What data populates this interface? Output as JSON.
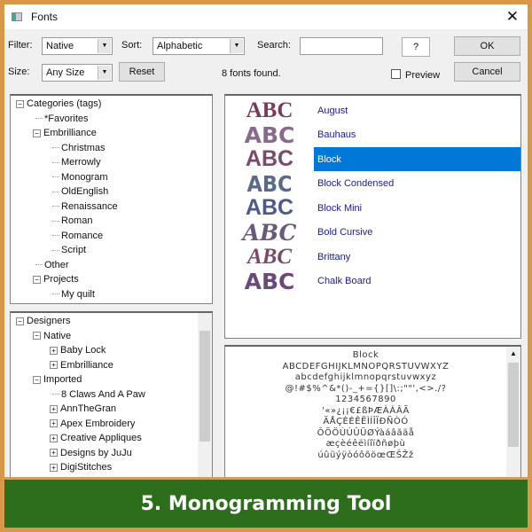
{
  "window": {
    "title": "Fonts",
    "close": "✕"
  },
  "toolbar": {
    "filter_label": "Filter:",
    "filter_value": "Native",
    "sort_label": "Sort:",
    "sort_value": "Alphabetic",
    "search_label": "Search:",
    "search_value": "",
    "help": "?",
    "ok": "OK",
    "size_label": "Size:",
    "size_value": "Any Size",
    "reset": "Reset",
    "found": "8 fonts found.",
    "preview": "Preview",
    "preview_checked": false,
    "cancel": "Cancel"
  },
  "categories": [
    {
      "label": "Categories (tags)",
      "level": 0,
      "box": "−"
    },
    {
      "label": "*Favorites",
      "level": 1
    },
    {
      "label": "Embrilliance",
      "level": 1,
      "box": "−"
    },
    {
      "label": "Christmas",
      "level": 2
    },
    {
      "label": "Merrowly",
      "level": 2
    },
    {
      "label": "Monogram",
      "level": 2
    },
    {
      "label": "OldEnglish",
      "level": 2
    },
    {
      "label": "Renaissance",
      "level": 2
    },
    {
      "label": "Roman",
      "level": 2
    },
    {
      "label": "Romance",
      "level": 2
    },
    {
      "label": "Script",
      "level": 2
    },
    {
      "label": "Other",
      "level": 1
    },
    {
      "label": "Projects",
      "level": 1,
      "box": "−"
    },
    {
      "label": "My quilt",
      "level": 2
    }
  ],
  "designers": [
    {
      "label": "Designers",
      "level": 0,
      "box": "−"
    },
    {
      "label": "Native",
      "level": 1,
      "box": "−"
    },
    {
      "label": "Baby Lock",
      "level": 2,
      "box": "+"
    },
    {
      "label": "Embrilliance",
      "level": 2,
      "box": "+"
    },
    {
      "label": "Imported",
      "level": 1,
      "box": "−"
    },
    {
      "label": "8 Claws And A Paw",
      "level": 2
    },
    {
      "label": "AnnTheGran",
      "level": 2,
      "box": "+"
    },
    {
      "label": "Apex Embroidery",
      "level": 2,
      "box": "+"
    },
    {
      "label": "Creative Appliques",
      "level": 2,
      "box": "+"
    },
    {
      "label": "Designs by JuJu",
      "level": 2,
      "box": "+"
    },
    {
      "label": "DigiStitches",
      "level": 2,
      "box": "+"
    }
  ],
  "fonts": [
    {
      "name": "August",
      "sample": "ABC",
      "color": "#7a3a5a"
    },
    {
      "name": "Bauhaus",
      "sample": "ABC",
      "color": "#8a6a8a"
    },
    {
      "name": "Block",
      "sample": "ABC",
      "color": "#7a4a6e",
      "selected": true
    },
    {
      "name": "Block Condensed",
      "sample": "ABC",
      "color": "#5a6a8a"
    },
    {
      "name": "Block Mini",
      "sample": "ABC",
      "color": "#4a5a8a"
    },
    {
      "name": "Bold Cursive",
      "sample": "ABC",
      "color": "#6a5a7a"
    },
    {
      "name": "Brittany",
      "sample": "ABC",
      "color": "#7a4a6a"
    },
    {
      "name": "Chalk Board",
      "sample": "ABC",
      "color": "#6a4a7a"
    }
  ],
  "preview_lines": [
    "Block",
    "ABCDEFGHIJKLMNOPQRSTUVWXYZ",
    "abcdefghijklmnopqrstuvwxyz",
    "@!#$%^&*()-_+={}[]\\:;\"\"',<>./?",
    "1234567890",
    "'«»¿¡¡€£ßÞÆÀÁÂÃ",
    "ÄÅÇÈÉÊËÌÍÎÏÐÑÒÓ",
    "ÔÕÖÙÚÛÜØÝàáâãäå",
    "æçèéêëìíîïðñøþù",
    "úûüýÿòóôõöœŒŠŽž"
  ],
  "banner": "5. Monogramming Tool"
}
